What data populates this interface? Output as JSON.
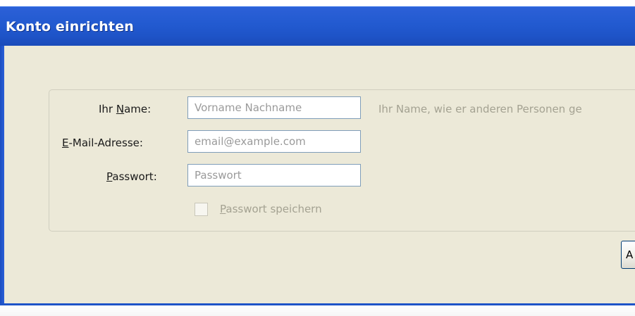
{
  "window": {
    "title": "Konto einrichten"
  },
  "form": {
    "name": {
      "label_prefix": "Ihr ",
      "label_accel": "N",
      "label_rest": "ame:",
      "placeholder": "Vorname Nachname",
      "value": "",
      "hint": "Ihr Name, wie er anderen Personen ge"
    },
    "email": {
      "label_accel": "E",
      "label_rest": "-Mail-Adresse:",
      "placeholder": "email@example.com",
      "value": ""
    },
    "password": {
      "label_accel": "P",
      "label_rest": "asswort:",
      "placeholder": "Passwort",
      "value": ""
    },
    "remember_password": {
      "label_accel": "P",
      "label_rest": "asswort speichern",
      "checked": false,
      "enabled": false
    }
  },
  "buttons": {
    "partial_button_label": "A"
  },
  "colors": {
    "titlebar_blue": "#225ad0",
    "dialog_background": "#ece9d8",
    "input_border": "#7f9db9",
    "disabled_text": "#a4a292"
  }
}
